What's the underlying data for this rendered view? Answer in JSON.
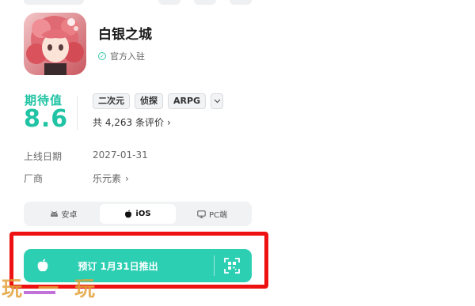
{
  "app": {
    "title": "白银之城",
    "official_label": "官方入驻"
  },
  "rating": {
    "label": "期待值",
    "value": "8.6",
    "reviews_text": "共 4,263 条评价",
    "tags": [
      "二次元",
      "侦探",
      "ARPG"
    ]
  },
  "info": {
    "release_label": "上线日期",
    "release_value": "2027-01-31",
    "vendor_label": "厂商",
    "vendor_value": "乐元素"
  },
  "platforms": {
    "tabs": [
      {
        "label": "安卓",
        "icon": "android-icon"
      },
      {
        "label": "iOS",
        "icon": "apple-icon",
        "active": true
      },
      {
        "label": "PC端",
        "icon": "monitor-icon"
      }
    ]
  },
  "reserve": {
    "label": "预订 1月31日推出"
  },
  "watermark": {
    "text": "玩一玩"
  },
  "colors": {
    "accent": "#20c3a3",
    "button": "#2dcfb2",
    "highlight": "#ee1111"
  }
}
